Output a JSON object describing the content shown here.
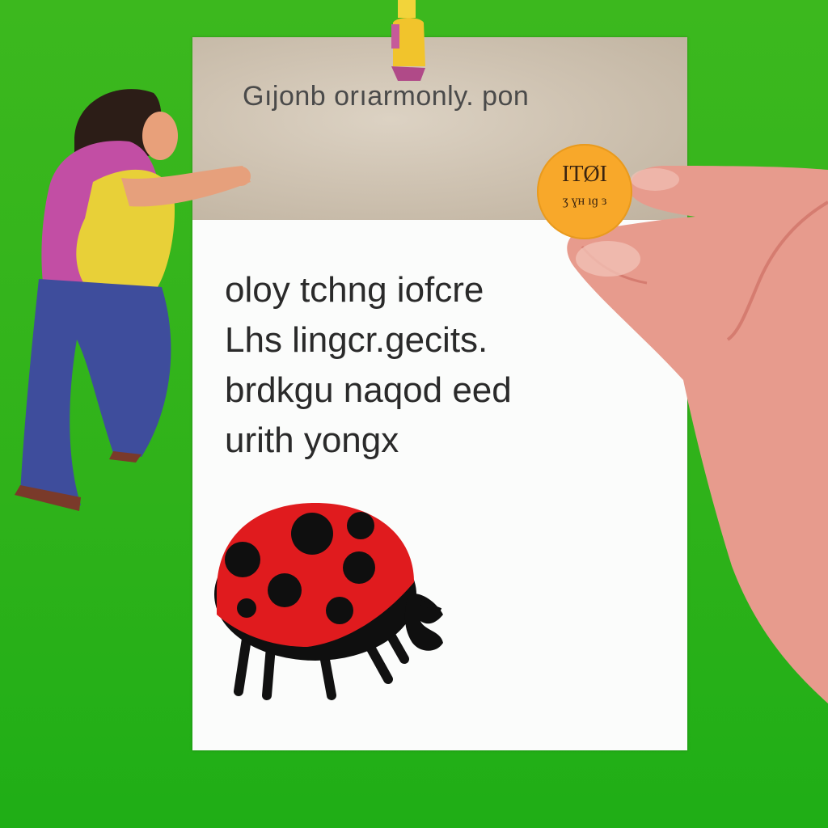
{
  "card": {
    "header_title": "Gıjonb orıarmonly. pon",
    "body_lines": [
      "oloy tchng iofcre",
      "Lhs lingcr.gecits.",
      "brdkgu  naqod eed",
      "urith yongx"
    ]
  },
  "sticker": {
    "line1": "ITØI",
    "line2": "ʒ ɣʜ ıɡ ɜ"
  },
  "colors": {
    "background": "#34b41c",
    "card": "#fbfcfb",
    "header": "#cfc3b2",
    "ladybug_red": "#e01b1e",
    "sticker": "#f8a82a"
  }
}
